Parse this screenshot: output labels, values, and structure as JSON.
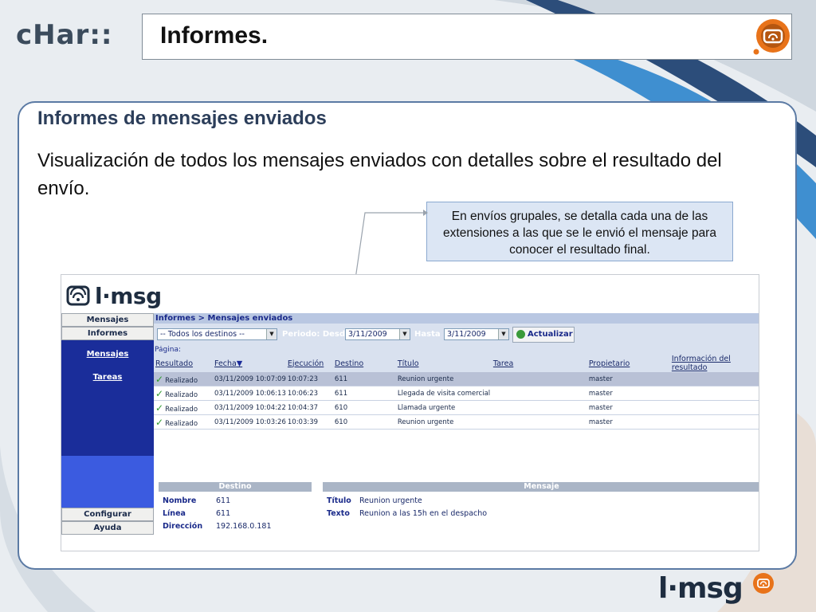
{
  "header": {
    "logo_text": "cHar::",
    "title": "Informes."
  },
  "slide": {
    "subtitle": "Informes de mensajes enviados",
    "description": "Visualización de todos los mensajes enviados con detalles sobre el resultado del envío.",
    "callout": "En envíos grupales, se detalla cada una de las extensiones a las que se le envió el mensaje para conocer el resultado final."
  },
  "app": {
    "logo_text": "l·msg",
    "sidebar": {
      "top_items": [
        "Mensajes",
        "Informes"
      ],
      "links": [
        "Mensajes",
        "Tareas"
      ],
      "bottom_items": [
        "Configurar",
        "Ayuda"
      ]
    },
    "breadcrumb": "Informes > Mensajes enviados",
    "filter": {
      "destinos_value": "-- Todos los destinos --",
      "periodo_label": "Periodo: Desde",
      "desde_value": "3/11/2009",
      "hasta_label": "Hasta",
      "hasta_value": "3/11/2009",
      "update_label": "Actualizar"
    },
    "pagination_label": "Página:",
    "table": {
      "headers": [
        "Resultado",
        "Fecha",
        "Ejecución",
        "Destino",
        "Título",
        "Tarea",
        "Propietario",
        "Información del resultado"
      ],
      "sort_indicator": "▼",
      "rows": [
        {
          "resultado": "Realizado",
          "fecha": "03/11/2009 10:07:09",
          "ejecucion": "10:07:23",
          "destino": "611",
          "titulo": "Reunion urgente",
          "tarea": "",
          "propietario": "master",
          "info": ""
        },
        {
          "resultado": "Realizado",
          "fecha": "03/11/2009 10:06:13",
          "ejecucion": "10:06:23",
          "destino": "611",
          "titulo": "Llegada de visita comercial",
          "tarea": "",
          "propietario": "master",
          "info": ""
        },
        {
          "resultado": "Realizado",
          "fecha": "03/11/2009 10:04:22",
          "ejecucion": "10:04:37",
          "destino": "610",
          "titulo": "Llamada urgente",
          "tarea": "",
          "propietario": "master",
          "info": ""
        },
        {
          "resultado": "Realizado",
          "fecha": "03/11/2009 10:03:26",
          "ejecucion": "10:03:39",
          "destino": "610",
          "titulo": "Reunion urgente",
          "tarea": "",
          "propietario": "master",
          "info": ""
        }
      ]
    },
    "destino_panel": {
      "header": "Destino",
      "nombre_label": "Nombre",
      "nombre_value": "611",
      "linea_label": "Línea",
      "linea_value": "611",
      "direccion_label": "Dirección",
      "direccion_value": "192.168.0.181"
    },
    "mensaje_panel": {
      "header": "Mensaje",
      "titulo_label": "Título",
      "titulo_value": "Reunion urgente",
      "texto_label": "Texto",
      "texto_value": "Reunion a las 15h en el despacho"
    }
  },
  "footer": {
    "logo_text": "l·msg"
  },
  "colors": {
    "accent_orange": "#e8731a",
    "sidebar_blue": "#1a2d9a",
    "border_blue": "#5b7aa4"
  }
}
